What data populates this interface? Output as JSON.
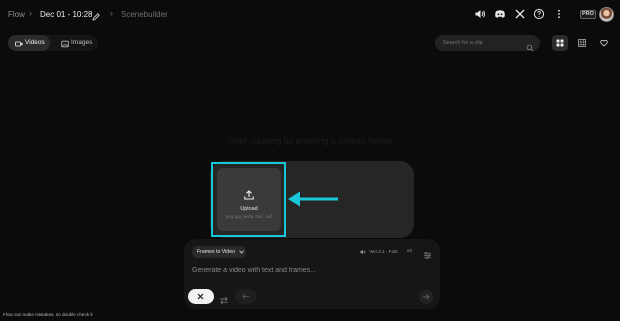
{
  "header": {
    "breadcrumb": {
      "root": "Flow",
      "separator": "›",
      "project_title": "Dec 01 - 10:28",
      "current_tool": "Scenebuilder"
    },
    "icons": [
      "volume-icon",
      "discord-icon",
      "x-icon",
      "help-icon",
      "more-icon"
    ],
    "plan_badge": "PRO"
  },
  "toolbar": {
    "tabs": [
      {
        "label": "Videos",
        "active": true
      },
      {
        "label": "Images",
        "active": false
      }
    ],
    "search_placeholder": "Search for a clip",
    "view_modes": [
      "grid-view",
      "list-view",
      "favorites"
    ]
  },
  "main": {
    "empty_message": "Start creating by entering a prompt below"
  },
  "frames": {
    "upload_label": "Upload",
    "upload_hint": "png, jpg, webp, heic, avif",
    "highlight_color": "#18c6d9"
  },
  "composer": {
    "mode": "Frames to Video",
    "model": "Veo 3.1 - Fast",
    "output_count": "x2",
    "prompt_placeholder": "Generate a video with text and frames...",
    "output_count_label": "x2"
  },
  "footer": {
    "disclaimer": "Flow can make mistakes, so double check it"
  },
  "colors": {
    "background": "#0b0b0b",
    "accent": "#18c6d9"
  }
}
